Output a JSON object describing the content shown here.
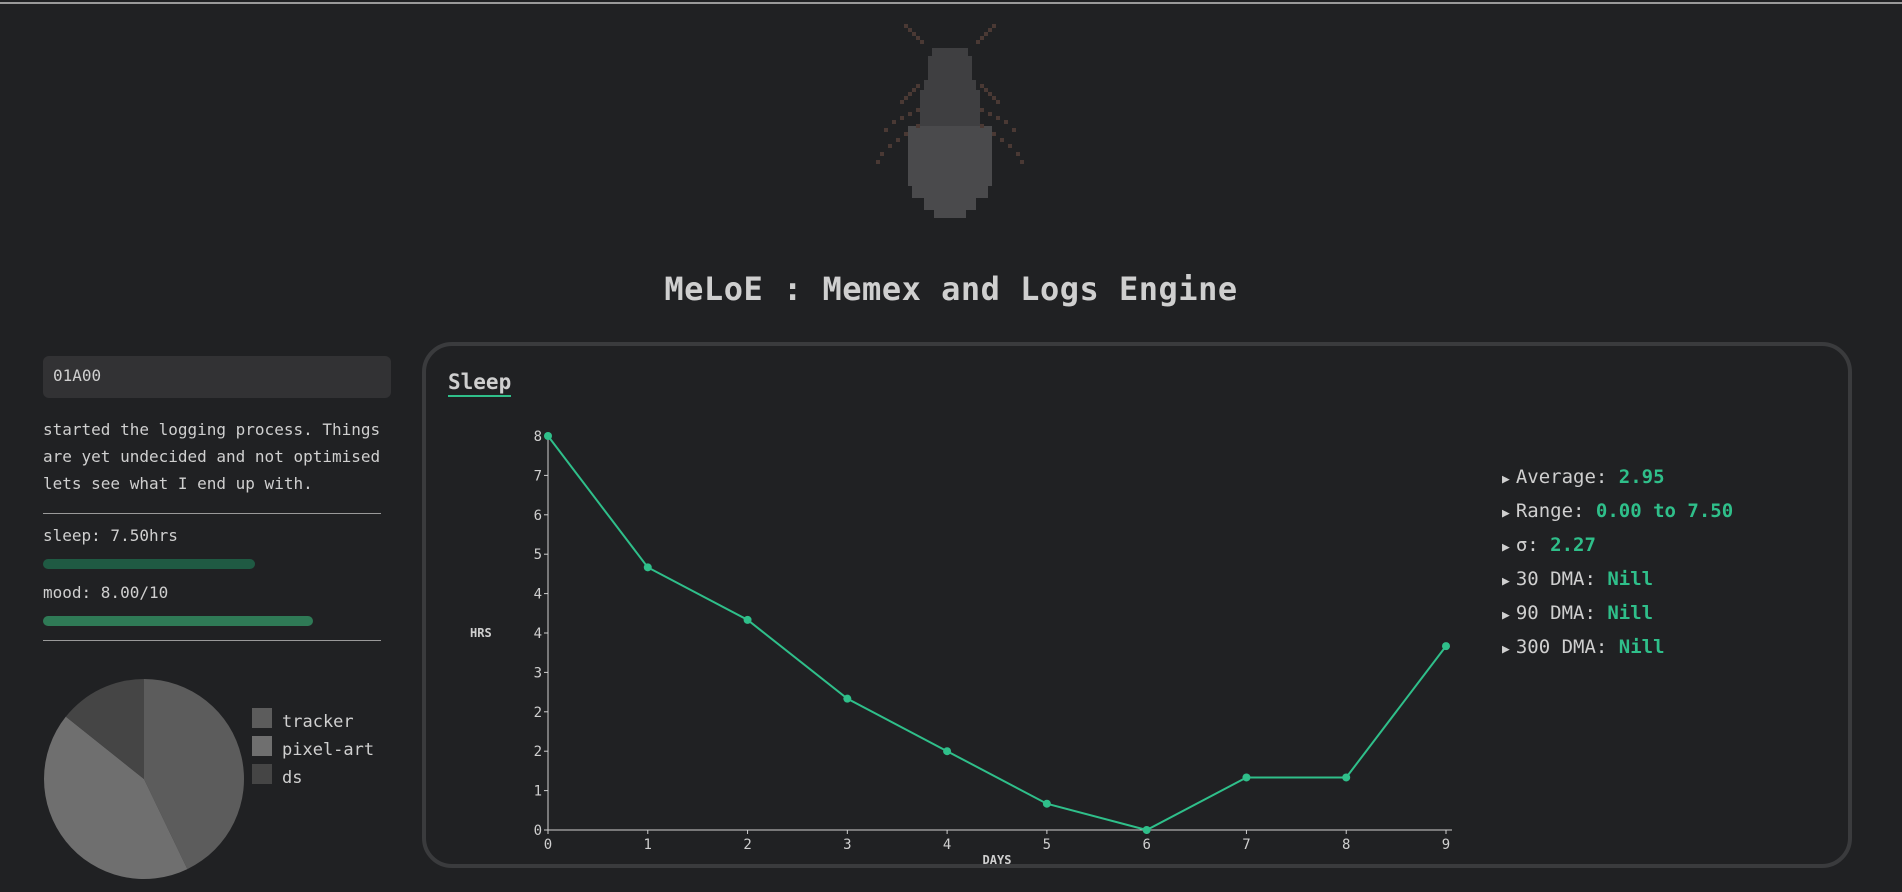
{
  "app": {
    "title": "MeLoE : Memex and Logs Engine",
    "logo": "pixel-art-beetle"
  },
  "log": {
    "id": "01A00",
    "text": "started the logging process. Things are yet undecided and not optimised lets see what I end up with.",
    "metrics": [
      {
        "label": "sleep: 7.50hrs",
        "fraction": 0.75,
        "color": "#1f5a43"
      },
      {
        "label": "mood: 8.00/10",
        "fraction": 0.8,
        "color": "#2f7a56"
      }
    ]
  },
  "tags": {
    "legend": [
      {
        "label": "tracker",
        "color": "#5c5c5c"
      },
      {
        "label": "pixel-art",
        "color": "#6f6f6f"
      },
      {
        "label": "ds",
        "color": "#454545"
      }
    ]
  },
  "panel": {
    "title": "Sleep",
    "stats": [
      {
        "label": "Average:",
        "value": "2.95"
      },
      {
        "label": "Range:",
        "value": "0.00 to 7.50"
      },
      {
        "label": "σ:",
        "value": "2.27"
      },
      {
        "label": "30 DMA:",
        "value": "Nill"
      },
      {
        "label": "90 DMA:",
        "value": "Nill"
      },
      {
        "label": "300 DMA:",
        "value": "Nill"
      }
    ]
  },
  "chart_data": [
    {
      "type": "line",
      "xlabel": "DAYS",
      "ylabel": "HRS",
      "x": [
        0,
        1,
        2,
        3,
        4,
        5,
        6,
        7,
        8,
        9
      ],
      "series": [
        {
          "values": [
            7.5,
            5.0,
            4.0,
            2.5,
            1.5,
            0.5,
            0.0,
            1.0,
            1.0,
            3.5
          ]
        }
      ],
      "xlim": [
        0,
        9
      ],
      "ylim": [
        0,
        7.5
      ],
      "yticks": [
        0,
        0.75,
        1.5,
        2.25,
        3.0,
        3.75,
        4.5,
        5.25,
        6.0,
        6.75,
        7.5
      ],
      "ytick_labels": [
        "0",
        "1",
        "2",
        "2",
        "3",
        "4",
        "4",
        "5",
        "6",
        "7",
        "8"
      ],
      "xtick_labels": [
        "0",
        "1",
        "2",
        "3",
        "4",
        "5",
        "6",
        "7",
        "8",
        "9"
      ],
      "color": "#2fbf8a",
      "grid": false
    },
    {
      "type": "pie",
      "categories": [
        "tracker",
        "pixel-art",
        "ds"
      ],
      "values": [
        3,
        3,
        1
      ],
      "colors": [
        "#5c5c5c",
        "#6f6f6f",
        "#454545"
      ]
    }
  ]
}
